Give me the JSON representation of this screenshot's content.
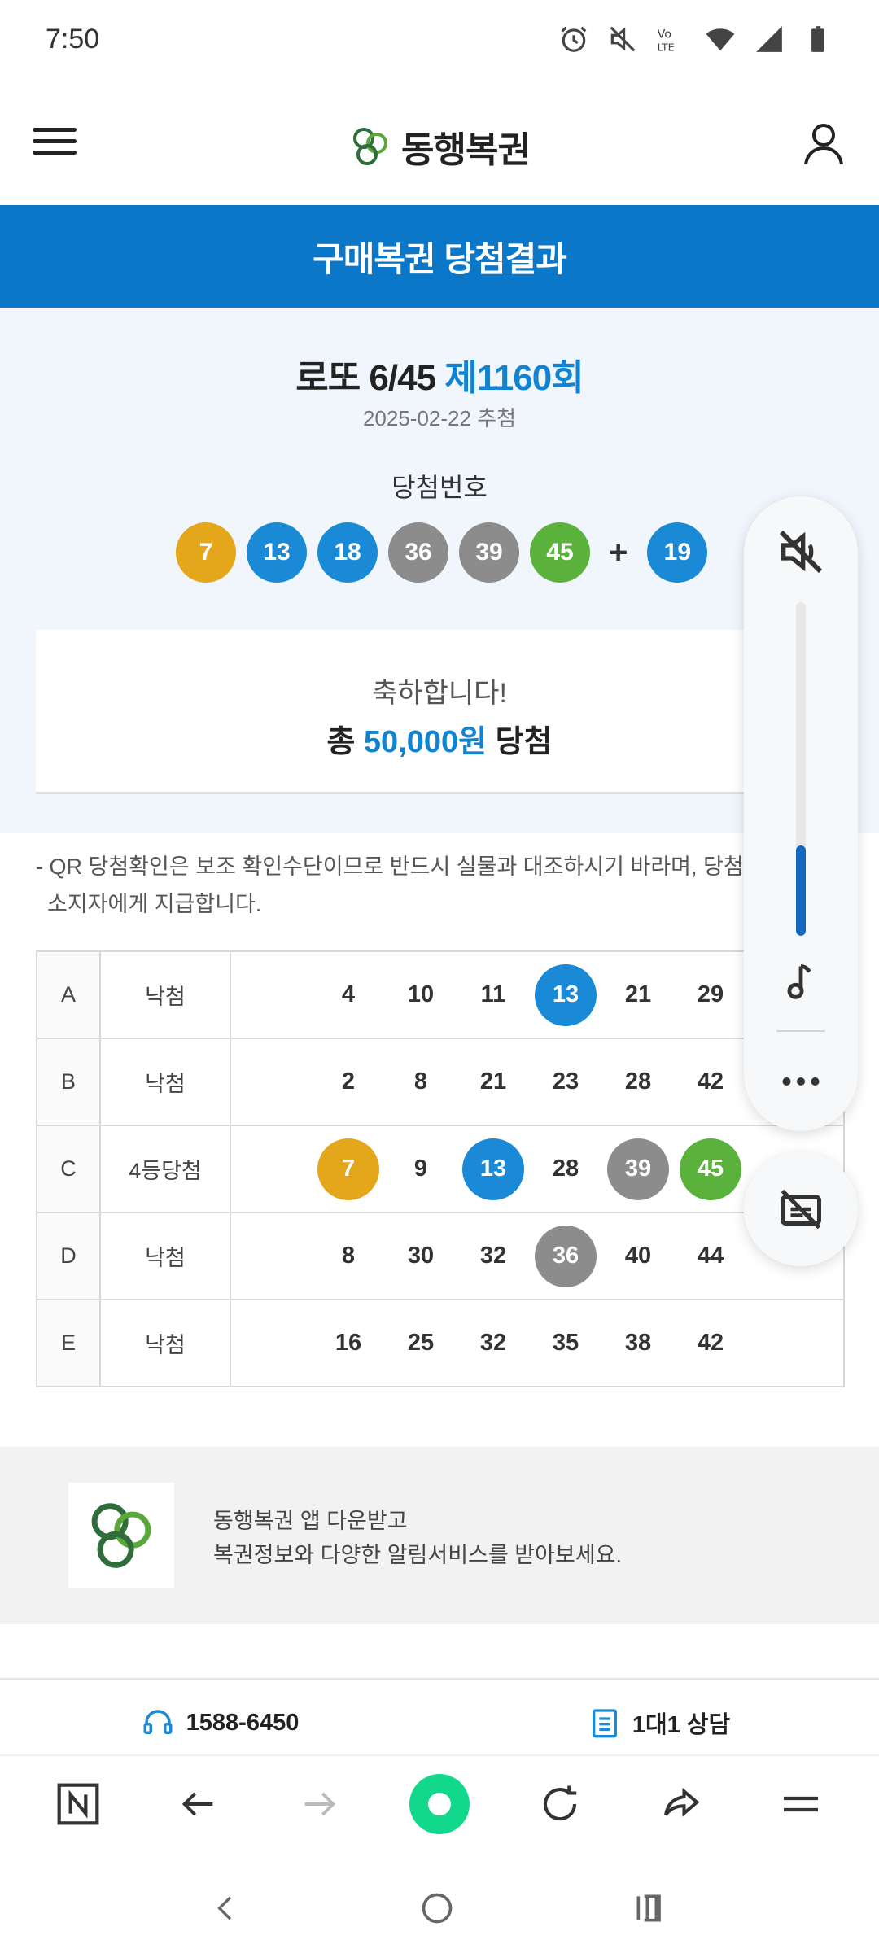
{
  "status_bar": {
    "time": "7:50",
    "icons": [
      "alarm-icon",
      "mute-icon",
      "volte-icon",
      "wifi-icon",
      "signal-icon",
      "battery-icon"
    ]
  },
  "header": {
    "logo_text": "동행복권"
  },
  "banner": {
    "title": "구매복권 당첨결과"
  },
  "result": {
    "game_name": "로또 6/45",
    "round": "제1160회",
    "draw_date": "2025-02-22 추첨",
    "winning_label": "당첨번호",
    "winning_numbers": [
      "7",
      "13",
      "18",
      "36",
      "39",
      "45"
    ],
    "plus": "+",
    "bonus_number": "19",
    "congrats": "축하합니다!",
    "prize_prefix": "총",
    "prize_amount": "50,000원",
    "prize_suffix": "당첨"
  },
  "notice": {
    "line1": "- QR 당첨확인은 보조 확인수단이므로 반드시 실물과 대조하시기 바라며, 당첨금은",
    "line2": "소지자에게 지급합니다."
  },
  "tickets": [
    {
      "game": "A",
      "status": "낙첨",
      "numbers": [
        "4",
        "10",
        "11",
        "13",
        "21",
        "29"
      ],
      "highlights": [
        "",
        "",
        "",
        "b",
        "",
        ""
      ]
    },
    {
      "game": "B",
      "status": "낙첨",
      "numbers": [
        "2",
        "8",
        "21",
        "23",
        "28",
        "42"
      ],
      "highlights": [
        "",
        "",
        "",
        "",
        "",
        ""
      ]
    },
    {
      "game": "C",
      "status": "4등당첨",
      "numbers": [
        "7",
        "9",
        "13",
        "28",
        "39",
        "45"
      ],
      "highlights": [
        "y",
        "",
        "b",
        "",
        "g",
        "gr"
      ]
    },
    {
      "game": "D",
      "status": "낙첨",
      "numbers": [
        "8",
        "30",
        "32",
        "36",
        "40",
        "44"
      ],
      "highlights": [
        "",
        "",
        "",
        "g",
        "",
        ""
      ]
    },
    {
      "game": "E",
      "status": "낙첨",
      "numbers": [
        "16",
        "25",
        "32",
        "35",
        "38",
        "42"
      ],
      "highlights": [
        "",
        "",
        "",
        "",
        "",
        ""
      ]
    }
  ],
  "app_banner": {
    "line1": "동행복권 앱 다운받고",
    "line2": "복권정보와 다양한 알림서비스를 받아보세요."
  },
  "contact": {
    "phone": "1588-6450",
    "consult": "1대1 상담"
  },
  "volume": {
    "level": 0.27
  },
  "colors": {
    "brand_blue": "#0a77c8",
    "ball_yellow": "#e4a61a",
    "ball_blue": "#1a8ad7",
    "ball_gray": "#8c8c8c",
    "ball_green": "#5ab23c"
  }
}
